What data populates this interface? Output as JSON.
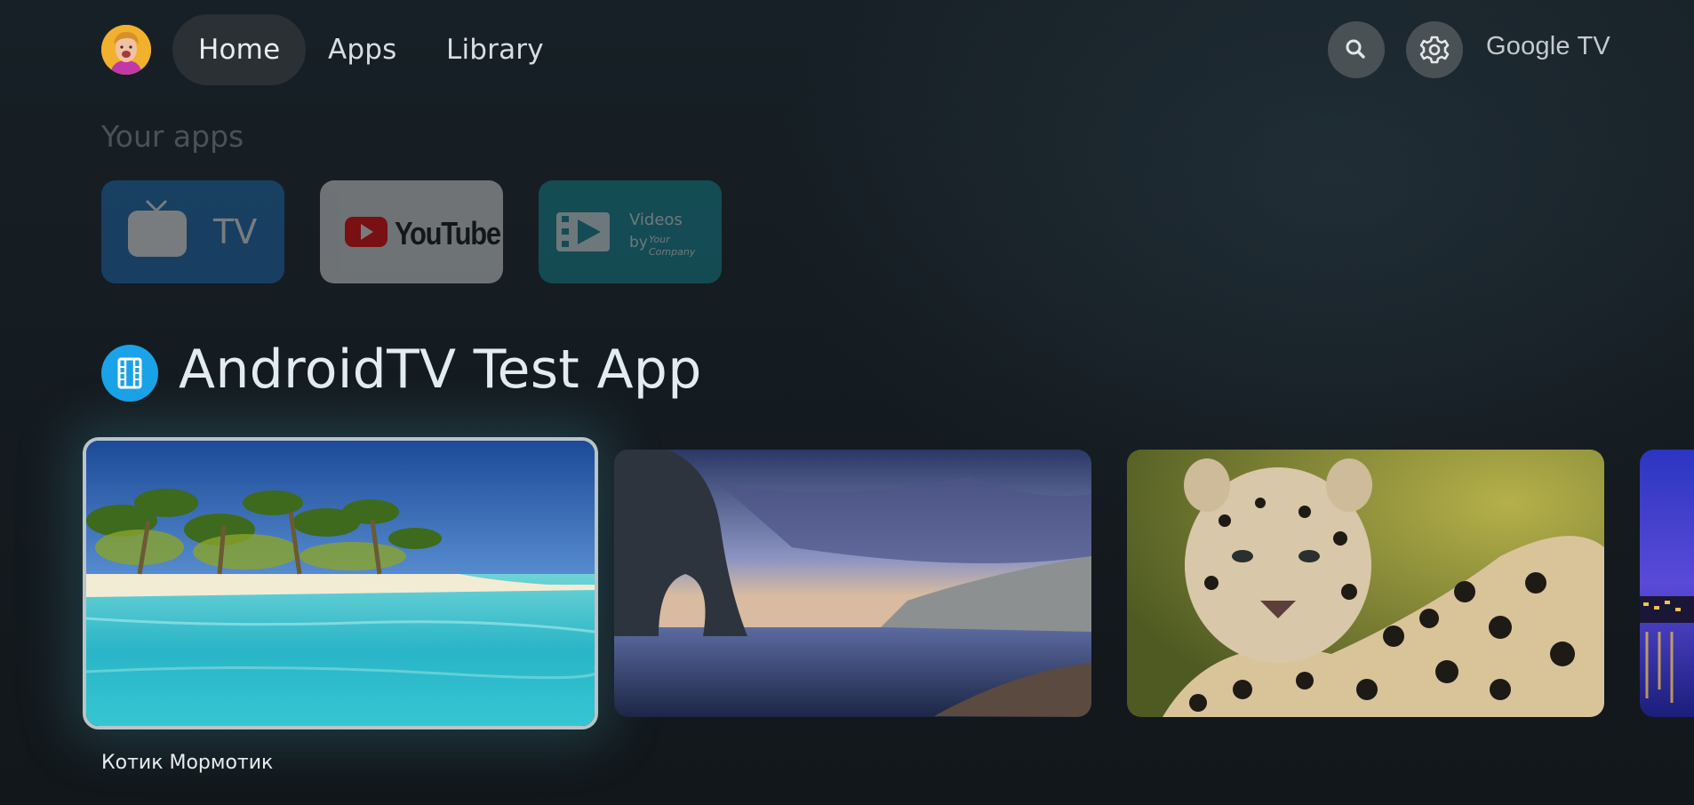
{
  "nav": {
    "tabs": [
      {
        "label": "Home",
        "active": true
      },
      {
        "label": "Apps",
        "active": false
      },
      {
        "label": "Library",
        "active": false
      }
    ],
    "brand": "Google TV",
    "icons": {
      "search": "search-icon",
      "settings": "gear-icon",
      "profile": "avatar"
    }
  },
  "your_apps": {
    "title": "Your apps",
    "apps": [
      {
        "name": "tv-app",
        "label": "TV"
      },
      {
        "name": "youtube-app",
        "label": "YouTube"
      },
      {
        "name": "videos-app",
        "line1": "Videos",
        "line2": "by",
        "line3": "Your Company"
      }
    ]
  },
  "featured": {
    "title": "AndroidTV Test App",
    "icon": "film-icon",
    "cards": [
      {
        "image": "tropical-beach",
        "caption": "Котик Мормотик",
        "focused": true
      },
      {
        "image": "rock-arch-seascape",
        "focused": false
      },
      {
        "image": "leopard",
        "focused": false
      },
      {
        "image": "night-city",
        "focused": false
      }
    ]
  },
  "colors": {
    "background": "#151b20",
    "active_tab": "#2a3034",
    "accent_icon": "#1aa3e8",
    "focus_border": "#b9c4c9"
  }
}
